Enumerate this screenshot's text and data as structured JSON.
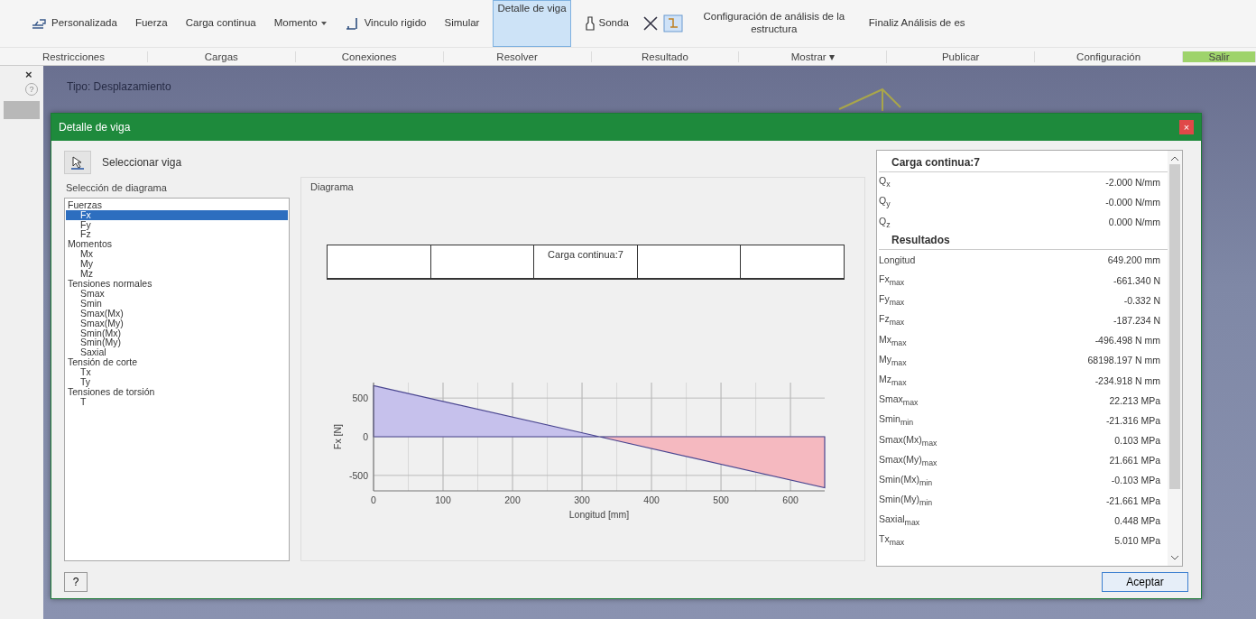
{
  "ribbon": {
    "buttons": [
      {
        "label": "Personalizada",
        "kind": "constraint",
        "selected": false
      },
      {
        "label": "Fuerza",
        "kind": "plain",
        "selected": false
      },
      {
        "label": "Carga continua",
        "kind": "plain",
        "selected": false
      },
      {
        "label": "Momento",
        "kind": "dropdown",
        "selected": false
      },
      {
        "label": "Vinculo rigido",
        "kind": "link",
        "selected": false
      },
      {
        "label": "Simular",
        "kind": "plain",
        "selected": false
      },
      {
        "label": "Detalle de viga",
        "kind": "plain",
        "selected": true
      },
      {
        "label": "Sonda",
        "kind": "probe",
        "selected": false
      },
      {
        "label": "Configuración de análisis de la estructura",
        "kind": "plain",
        "selected": false
      },
      {
        "label": "Finaliz Análisis de es",
        "kind": "plain",
        "selected": false
      }
    ],
    "groups": [
      {
        "label": "Restricciones",
        "kind": "plain"
      },
      {
        "label": "Cargas",
        "kind": "plain"
      },
      {
        "label": "Conexiones",
        "kind": "plain"
      },
      {
        "label": "Resolver",
        "kind": "plain"
      },
      {
        "label": "Resultado",
        "kind": "plain"
      },
      {
        "label": "Mostrar ▾",
        "kind": "plain"
      },
      {
        "label": "Publicar",
        "kind": "plain"
      },
      {
        "label": "Configuración",
        "kind": "plain"
      },
      {
        "label": "Salir",
        "kind": "exit"
      }
    ]
  },
  "side_panel": {
    "close": "×",
    "help": "?"
  },
  "viewport": {
    "info": "Tipo: Desplazamiento"
  },
  "dialog": {
    "title": "Detalle de viga",
    "close": "×",
    "select_button": "Seleccionar viga",
    "diagram_selection": {
      "title": "Selección de diagrama",
      "items": [
        {
          "label": "Fuerzas",
          "selected": false,
          "children": [
            {
              "label": "Fx",
              "selected": true
            },
            {
              "label": "Fy",
              "selected": false
            },
            {
              "label": "Fz",
              "selected": false
            }
          ]
        },
        {
          "label": "Momentos",
          "selected": false,
          "children": [
            {
              "label": "Mx",
              "selected": false
            },
            {
              "label": "My",
              "selected": false
            },
            {
              "label": "Mz",
              "selected": false
            }
          ]
        },
        {
          "label": "Tensiones normales",
          "selected": false,
          "children": [
            {
              "label": "Smax",
              "selected": false
            },
            {
              "label": "Smin",
              "selected": false
            },
            {
              "label": "Smax(Mx)",
              "selected": false
            },
            {
              "label": "Smax(My)",
              "selected": false
            },
            {
              "label": "Smin(Mx)",
              "selected": false
            },
            {
              "label": "Smin(My)",
              "selected": false
            },
            {
              "label": "Saxial",
              "selected": false
            }
          ]
        },
        {
          "label": "Tensión de corte",
          "selected": false,
          "children": [
            {
              "label": "Tx",
              "selected": false
            },
            {
              "label": "Ty",
              "selected": false
            }
          ]
        },
        {
          "label": "Tensiones de torsión",
          "selected": false,
          "children": [
            {
              "label": "T",
              "selected": false
            }
          ]
        }
      ]
    },
    "diagram": {
      "title": "Diagrama",
      "beam_label": "Carga continua:7",
      "chart_data": {
        "type": "area",
        "xlabel": "Longitud [mm]",
        "ylabel": "Fx [N]",
        "x": [
          0,
          325,
          649.2
        ],
        "series": [
          {
            "color": "#c6c1ec",
            "values": [
              660,
              0,
              null
            ]
          },
          {
            "color": "#f5b9c0",
            "values": [
              null,
              0,
              -660
            ]
          }
        ],
        "grid": true,
        "xlim": [
          0,
          649.2
        ],
        "ylim": [
          -700,
          700
        ],
        "xticks": [
          0,
          100,
          200,
          300,
          400,
          500,
          600
        ],
        "yticks": [
          -500,
          0,
          500
        ]
      }
    },
    "properties": {
      "sections": [
        {
          "title": "Carga continua:7",
          "rows": [
            {
              "name": "Q$_{x}$",
              "value": "-2.000 N/mm"
            },
            {
              "name": "Q$_{y}$",
              "value": "-0.000 N/mm"
            },
            {
              "name": "Q$_{z}$",
              "value": "0.000 N/mm"
            }
          ]
        },
        {
          "title": "Resultados",
          "rows": [
            {
              "name": "Longitud",
              "value": "649.200 mm"
            },
            {
              "name": "Fx$_{max}$",
              "value": "-661.340 N"
            },
            {
              "name": "Fy$_{max}$",
              "value": "-0.332 N"
            },
            {
              "name": "Fz$_{max}$",
              "value": "-187.234 N"
            },
            {
              "name": "Mx$_{max}$",
              "value": "-496.498 N mm"
            },
            {
              "name": "My$_{max}$",
              "value": "68198.197 N mm"
            },
            {
              "name": "Mz$_{max}$",
              "value": "-234.918 N mm"
            },
            {
              "name": "Smax$_{max}$",
              "value": "22.213 MPa"
            },
            {
              "name": "Smin$_{min}$",
              "value": "-21.316 MPa"
            },
            {
              "name": "Smax(Mx)$_{max}$",
              "value": "0.103 MPa"
            },
            {
              "name": "Smax(My)$_{max}$",
              "value": "21.661 MPa"
            },
            {
              "name": "Smin(Mx)$_{min}$",
              "value": "-0.103 MPa"
            },
            {
              "name": "Smin(My)$_{min}$",
              "value": "-21.661 MPa"
            },
            {
              "name": "Saxial$_{max}$",
              "value": "0.448 MPa"
            },
            {
              "name": "Tx$_{max}$",
              "value": "5.010 MPa"
            }
          ]
        }
      ]
    },
    "help_button": "?",
    "ok_button": "Aceptar"
  }
}
